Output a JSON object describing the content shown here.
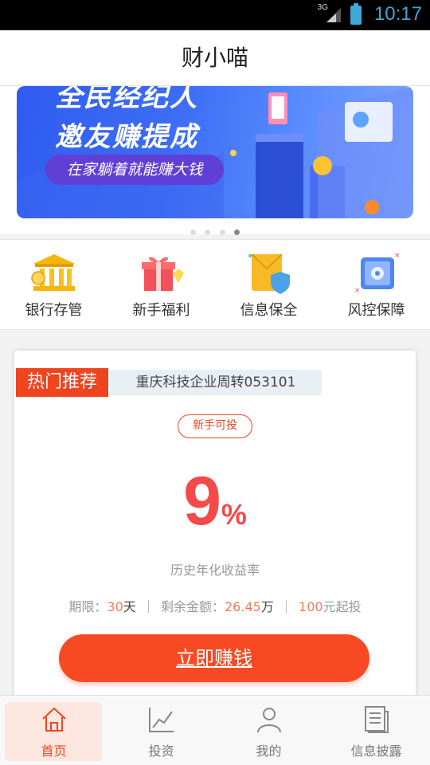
{
  "status_bar": {
    "network": "3G",
    "time": "10:17"
  },
  "header": {
    "title": "财小喵"
  },
  "banner": {
    "headline_1": "全民经纪人",
    "headline_2": "邀友赚提成",
    "tagline": "在家躺着就能赚大钱",
    "slide_count": 4,
    "active_slide": 4
  },
  "quick_nav": [
    {
      "label": "银行存管",
      "icon": "bank-icon"
    },
    {
      "label": "新手福利",
      "icon": "gift-icon"
    },
    {
      "label": "信息保全",
      "icon": "document-shield-icon"
    },
    {
      "label": "风控保障",
      "icon": "safe-icon"
    }
  ],
  "product": {
    "tag": "热门推荐",
    "name": "重庆科技企业周转053101",
    "badge": "新手可投",
    "rate": "9",
    "rate_unit": "%",
    "rate_label": "历史年化收益率",
    "term_label": "期限：",
    "term_value": "30",
    "term_unit": "天",
    "remaining_label": "剩余金额：",
    "remaining_value": "26.45",
    "remaining_unit": "万",
    "min_value": "100",
    "min_unit": "元起投",
    "cta": "立即赚钱"
  },
  "bottom_nav": [
    {
      "label": "首页",
      "icon": "home-icon",
      "active": true
    },
    {
      "label": "投资",
      "icon": "chart-icon",
      "active": false
    },
    {
      "label": "我的",
      "icon": "user-icon",
      "active": false
    },
    {
      "label": "信息披露",
      "icon": "document-icon",
      "active": false
    }
  ],
  "colors": {
    "accent": "#f0441f",
    "rate": "#f44a4a",
    "banner": "#3d6df5"
  }
}
